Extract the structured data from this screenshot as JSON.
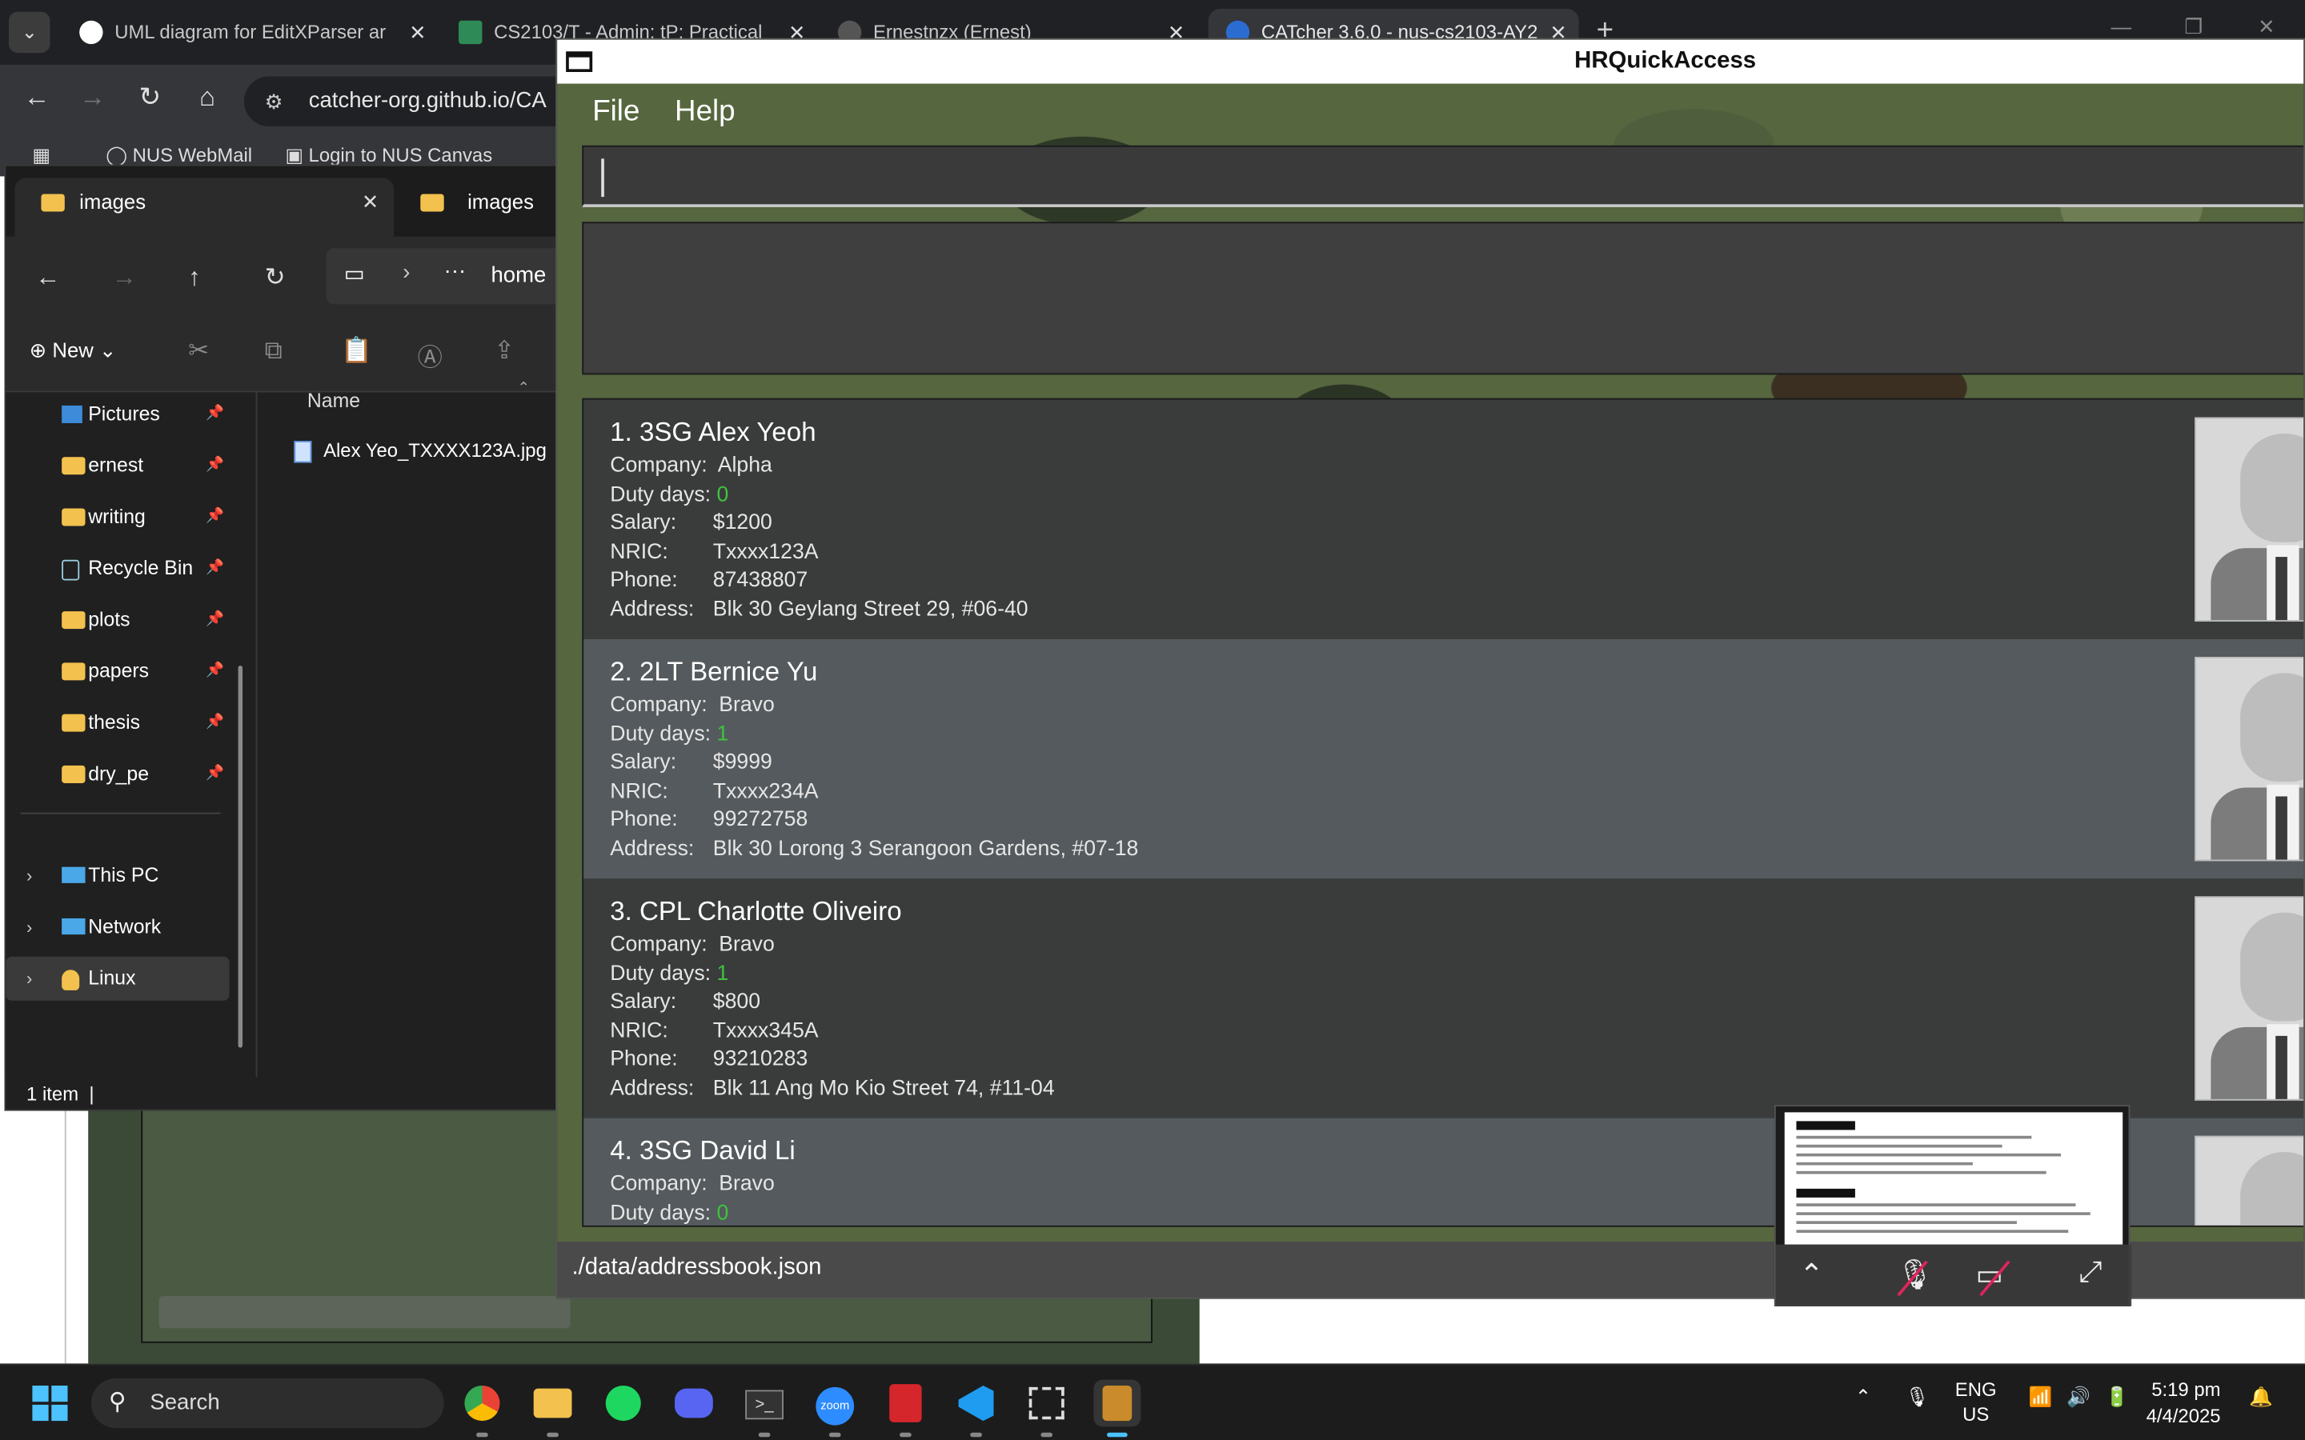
{
  "browser": {
    "tabs": [
      {
        "label": "UML diagram for EditXParser ar"
      },
      {
        "label": "CS2103/T - Admin: tP: Practical"
      },
      {
        "label": "Ernestnzx (Ernest)"
      },
      {
        "label": "CATcher 3.6.0 - nus-cs2103-AY2"
      }
    ],
    "url": "catcher-org.github.io/CA",
    "bookmarks": [
      "NUS WebMail",
      "Login to NUS Canvas"
    ]
  },
  "explorer": {
    "tabs": [
      "images",
      "images"
    ],
    "address": "home",
    "new_label": "New",
    "column_name": "Name",
    "pinned": [
      "Pictures",
      "ernest",
      "writing",
      "Recycle Bin",
      "plots",
      "papers",
      "thesis",
      "dry_pe"
    ],
    "drives": [
      "This PC",
      "Network",
      "Linux"
    ],
    "files": [
      "Alex Yeo_TXXXX123A.jpg"
    ],
    "status": "1 item"
  },
  "app": {
    "title": "HRQuickAccess",
    "menu": {
      "file": "File",
      "help": "Help"
    },
    "command_value": "",
    "result_text": "",
    "labels": {
      "company": "Company:",
      "duty": "Duty days:",
      "salary": "Salary:",
      "nric": "NRIC:",
      "phone": "Phone:",
      "address": "Address:"
    },
    "persons": [
      {
        "name": "1. 3SG Alex Yeoh",
        "company": "Alpha",
        "duty": "0",
        "salary": "$1200",
        "nric": "Txxxx123A",
        "phone": "87438807",
        "address": "Blk 30 Geylang Street 29, #06-40"
      },
      {
        "name": "2. 2LT Bernice Yu",
        "company": "Bravo",
        "duty": "1",
        "salary": "$9999",
        "nric": "Txxxx234A",
        "phone": "99272758",
        "address": "Blk 30 Lorong 3 Serangoon Gardens, #07-18"
      },
      {
        "name": "3. CPL Charlotte Oliveiro",
        "company": "Bravo",
        "duty": "1",
        "salary": "$800",
        "nric": "Txxxx345A",
        "phone": "93210283",
        "address": "Blk 11 Ang Mo Kio Street 74, #11-04"
      },
      {
        "name": "4. 3SG David Li",
        "company": "Bravo",
        "duty": "0"
      }
    ],
    "status_path": "./data/addressbook.json"
  },
  "taskbar": {
    "search": "Search",
    "lang": "ENG",
    "region": "US",
    "time": "5:19 pm",
    "date": "4/4/2025"
  }
}
